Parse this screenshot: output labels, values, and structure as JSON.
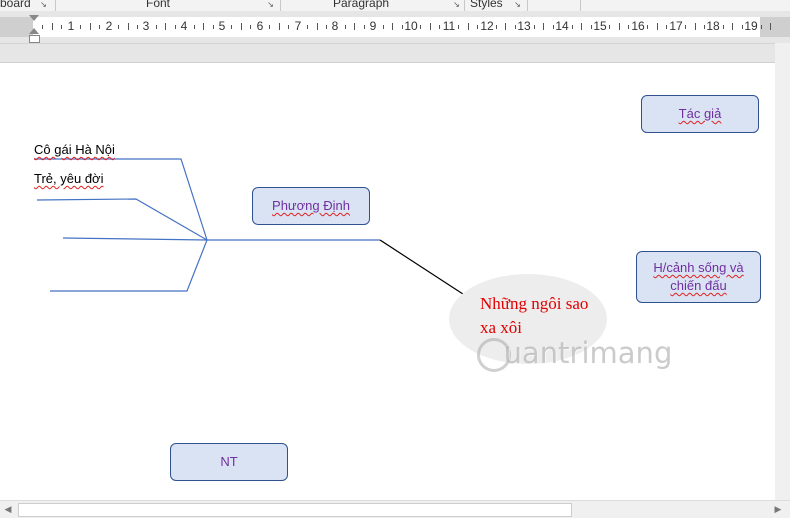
{
  "ribbon": {
    "groups": [
      "board",
      "Font",
      "Paragraph",
      "Styles"
    ]
  },
  "ruler": {
    "numbers": [
      "1",
      "2",
      "3",
      "4",
      "5",
      "6",
      "7",
      "8",
      "9",
      "10",
      "11",
      "12",
      "13",
      "14",
      "15",
      "16",
      "17",
      "18",
      "19"
    ]
  },
  "diagram": {
    "branch_labels": [
      "Cô gái Hà Nội",
      "Trẻ, yêu đời"
    ],
    "center_box": "Phương Định",
    "ellipse_text": "Những ngôi sao xa xôi",
    "author_box": "Tác giả",
    "context_box": "H/cảnh sống và chiến đấu",
    "nt_box": "NT"
  },
  "watermark": {
    "text": "uantrimang"
  },
  "colors": {
    "box_fill": "#dae3f3",
    "box_border": "#2f528f",
    "box_text": "#7030a0",
    "ellipse_text": "#e00000",
    "connector_line": "#4472c4"
  }
}
